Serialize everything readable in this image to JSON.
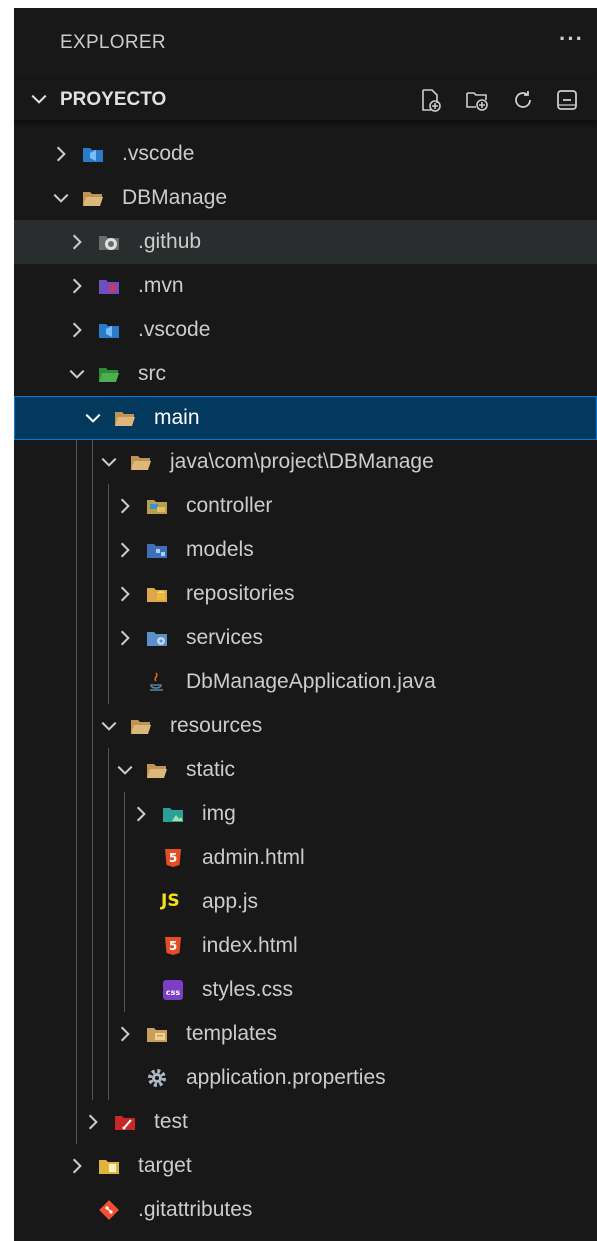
{
  "explorer": {
    "title": "EXPLORER",
    "more": "···"
  },
  "section": {
    "title": "PROYECTO",
    "toolbar": [
      "new-file-icon",
      "new-folder-icon",
      "refresh-icon",
      "collapse-all-icon"
    ]
  },
  "tree": [
    {
      "label": ".vscode",
      "icon": "vscode-folder-icon",
      "expanded": false
    },
    {
      "label": "DBManage",
      "icon": "folder-icon",
      "expanded": true
    },
    {
      "label": ".github",
      "icon": "github-folder-icon",
      "expanded": false,
      "state": "hover"
    },
    {
      "label": ".mvn",
      "icon": "maven-folder-icon",
      "expanded": false
    },
    {
      "label": ".vscode",
      "icon": "vscode-folder-icon",
      "expanded": false
    },
    {
      "label": "src",
      "icon": "src-folder-icon",
      "expanded": true
    },
    {
      "label": "main",
      "icon": "folder-icon",
      "expanded": true,
      "state": "selected"
    },
    {
      "label": "java\\com\\project\\DBManage",
      "icon": "folder-icon",
      "expanded": true
    },
    {
      "label": "controller",
      "icon": "controller-folder-icon",
      "expanded": false
    },
    {
      "label": "models",
      "icon": "models-folder-icon",
      "expanded": false
    },
    {
      "label": "repositories",
      "icon": "repositories-folder-icon",
      "expanded": false
    },
    {
      "label": "services",
      "icon": "services-folder-icon",
      "expanded": false
    },
    {
      "label": "DbManageApplication.java",
      "icon": "java-file-icon"
    },
    {
      "label": "resources",
      "icon": "folder-icon",
      "expanded": true
    },
    {
      "label": "static",
      "icon": "folder-icon",
      "expanded": true
    },
    {
      "label": "img",
      "icon": "images-folder-icon",
      "expanded": false
    },
    {
      "label": "admin.html",
      "icon": "html-file-icon",
      "badge": "5"
    },
    {
      "label": "app.js",
      "icon": "js-file-icon",
      "badge": "JS"
    },
    {
      "label": "index.html",
      "icon": "html-file-icon",
      "badge": "5"
    },
    {
      "label": "styles.css",
      "icon": "css-file-icon",
      "badge": "css"
    },
    {
      "label": "templates",
      "icon": "templates-folder-icon",
      "expanded": false
    },
    {
      "label": "application.properties",
      "icon": "gear-icon"
    },
    {
      "label": "test",
      "icon": "test-folder-icon",
      "expanded": false
    },
    {
      "label": "target",
      "icon": "target-folder-icon",
      "expanded": false
    },
    {
      "label": ".gitattributes",
      "icon": "git-file-icon"
    }
  ],
  "colors": {
    "background": "#181818",
    "selected_bg": "#04395e",
    "selected_border": "#0078d4",
    "hover_bg": "#2a2d2e",
    "text": "#cccccc",
    "folder": "#dcb67a",
    "html": "#e44d26",
    "js": "#f5de19",
    "css": "#7d3ec6"
  }
}
